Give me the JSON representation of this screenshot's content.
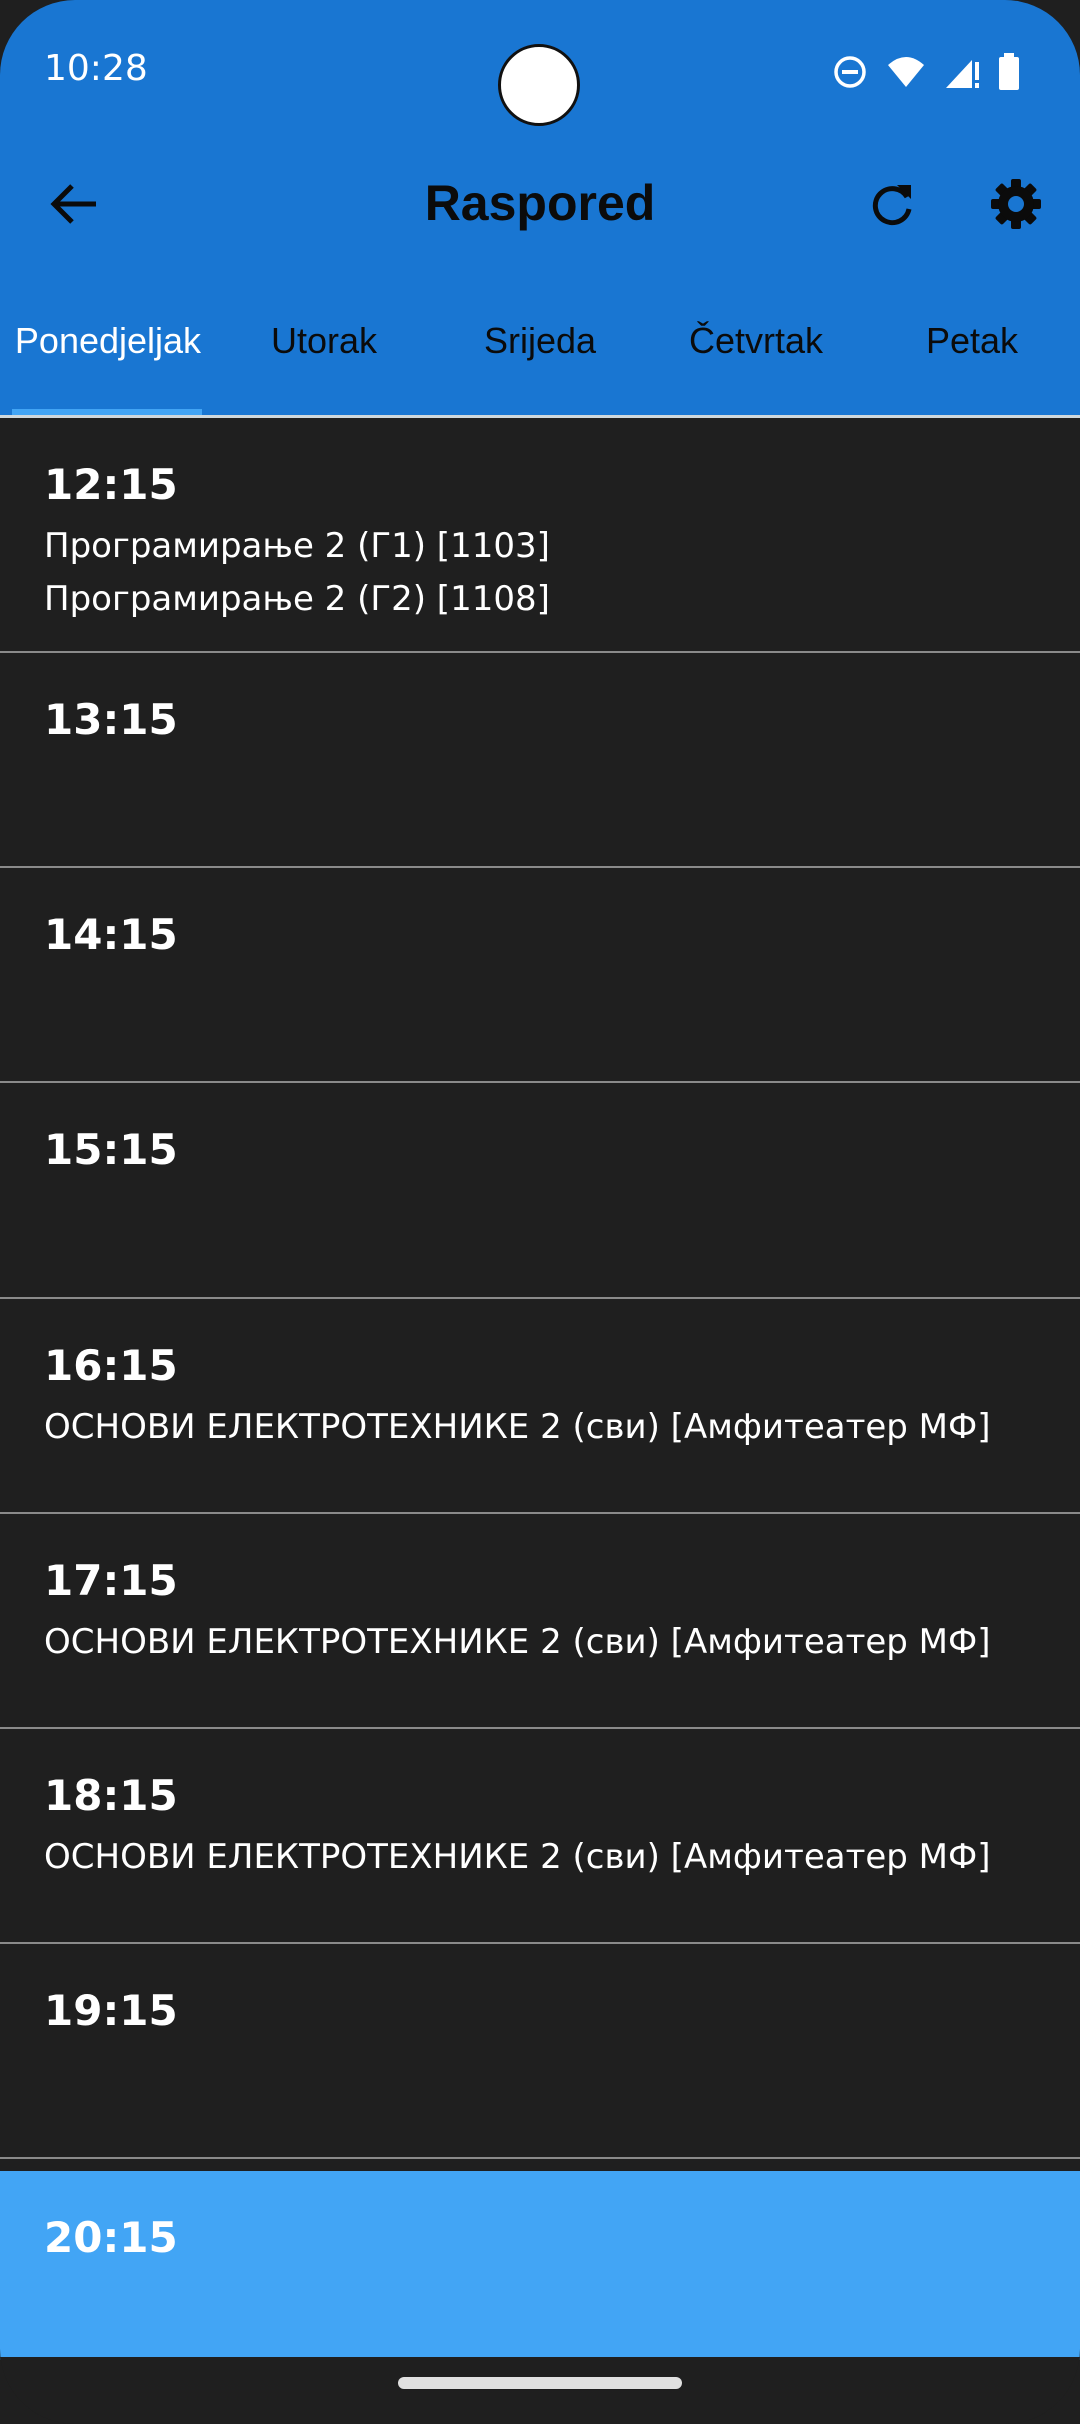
{
  "status_bar": {
    "time": "10:28",
    "icons": [
      "do-not-disturb-icon",
      "wifi-icon",
      "signal-icon",
      "battery-icon"
    ]
  },
  "toolbar": {
    "title": "Raspored",
    "back_icon": "arrow-back-icon",
    "refresh_icon": "refresh-icon",
    "settings_icon": "gear-icon"
  },
  "tabs": [
    {
      "label": "Ponedjeljak",
      "active": true
    },
    {
      "label": "Utorak",
      "active": false
    },
    {
      "label": "Srijeda",
      "active": false
    },
    {
      "label": "Četvrtak",
      "active": false
    },
    {
      "label": "Petak",
      "active": false
    }
  ],
  "schedule": [
    {
      "time": "12:15",
      "entries": [
        "Програмирање 2 (Г1) [1103]",
        "Програмирање 2 (Г2) [1108]"
      ]
    },
    {
      "time": "13:15",
      "entries": []
    },
    {
      "time": "14:15",
      "entries": []
    },
    {
      "time": "15:15",
      "entries": []
    },
    {
      "time": "16:15",
      "entries": [
        "ОСНОВИ ЕЛЕКТРОТЕХНИКЕ 2 (сви) [Амфитеатер МФ]"
      ]
    },
    {
      "time": "17:15",
      "entries": [
        "ОСНОВИ ЕЛЕКТРОТЕХНИКЕ 2 (сви) [Амфитеатер МФ]"
      ]
    },
    {
      "time": "18:15",
      "entries": [
        "ОСНОВИ ЕЛЕКТРОТЕХНИКЕ 2 (сви) [Амфитеатер МФ]"
      ]
    },
    {
      "time": "19:15",
      "entries": []
    },
    {
      "time": "20:15",
      "entries": [],
      "highlighted": true
    }
  ],
  "colors": {
    "app_bar": "#1976d2",
    "highlight": "#42a5f5",
    "background": "#1f1f1f"
  }
}
